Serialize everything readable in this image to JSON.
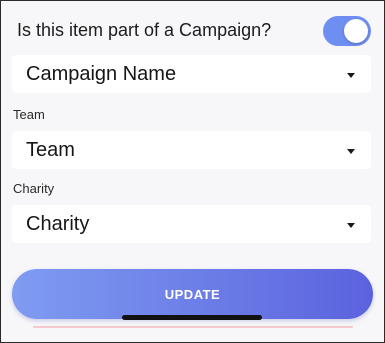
{
  "campaign_toggle": {
    "label": "Is this item part of a Campaign?",
    "on": true,
    "accent_color": "#6f8ef2"
  },
  "fields": {
    "campaign": {
      "value": "Campaign Name"
    },
    "team": {
      "label": "Team",
      "value": "Team"
    },
    "charity": {
      "label": "Charity",
      "value": "Charity"
    }
  },
  "update_button": {
    "label": "UPDATE",
    "gradient": [
      "#7f9cf1",
      "#5b62de"
    ]
  }
}
